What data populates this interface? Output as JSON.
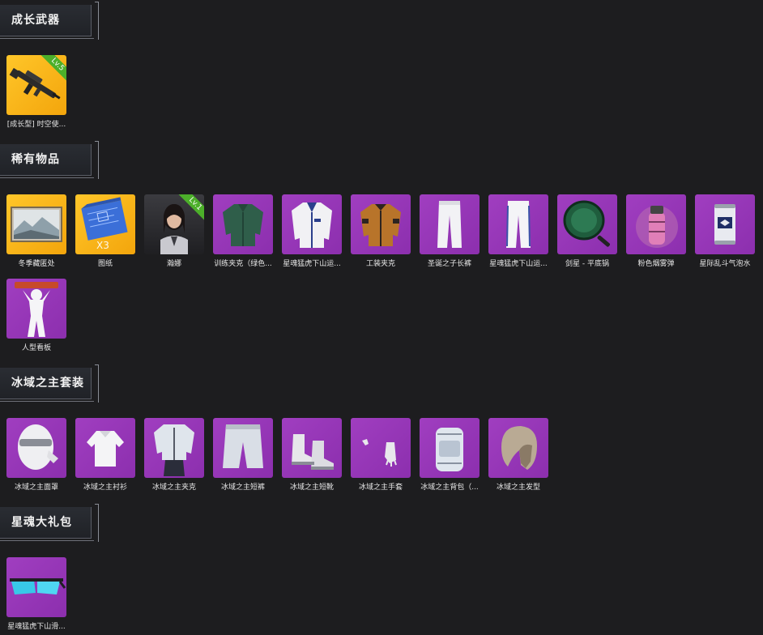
{
  "sections": {
    "growth": {
      "title": "成长武器"
    },
    "rare": {
      "title": "稀有物品"
    },
    "ice": {
      "title": "冰域之主套装"
    },
    "star": {
      "title": "星魂大礼包"
    }
  },
  "items": {
    "g1": {
      "label": "[成长型] 时空使...",
      "badge": "Lv.5",
      "icon": "rifle-icon"
    },
    "r1": {
      "label": "冬季藏匿处",
      "icon": "winter-painting-icon"
    },
    "r2": {
      "label": "图纸",
      "qty": "X3",
      "icon": "blueprint-icon"
    },
    "r3": {
      "label": "瀚娜",
      "badge": "Lv.1",
      "icon": "character-portrait-icon"
    },
    "r4": {
      "label": "训练夹克（绿色...",
      "icon": "green-jacket-icon"
    },
    "r5": {
      "label": "星魂猛虎下山运...",
      "icon": "white-jacket-icon"
    },
    "r6": {
      "label": "工装夹克",
      "icon": "work-jacket-icon"
    },
    "r7": {
      "label": "圣诞之子长裤",
      "icon": "white-pants-icon"
    },
    "r8": {
      "label": "星魂猛虎下山运...",
      "icon": "sport-pants-icon"
    },
    "r9": {
      "label": "剑星 - 平底锅",
      "icon": "pan-icon"
    },
    "r10": {
      "label": "粉色烟雾弹",
      "icon": "smoke-grenade-icon"
    },
    "r11": {
      "label": "星际乱斗气泡水",
      "icon": "soda-can-icon"
    },
    "r12": {
      "label": "人型看板",
      "icon": "human-signboard-icon"
    },
    "i1": {
      "label": "冰域之主面罩",
      "icon": "mask-icon"
    },
    "i2": {
      "label": "冰域之主衬衫",
      "icon": "shirt-icon"
    },
    "i3": {
      "label": "冰域之主夹克",
      "icon": "ice-jacket-icon"
    },
    "i4": {
      "label": "冰域之主短裤",
      "icon": "shorts-icon"
    },
    "i5": {
      "label": "冰域之主短靴",
      "icon": "boots-icon"
    },
    "i6": {
      "label": "冰域之主手套",
      "icon": "gloves-icon"
    },
    "i7": {
      "label": "冰域之主背包（...",
      "icon": "backpack-icon"
    },
    "i8": {
      "label": "冰域之主发型",
      "icon": "hairstyle-icon"
    },
    "s1": {
      "label": "星魂猛虎下山滑...",
      "icon": "goggles-icon"
    }
  },
  "colors": {
    "background": "#1d1d1f",
    "gold_tile": "#ffc629",
    "purple_tile": "#9a38bb",
    "level_badge": "#4caf2a"
  }
}
